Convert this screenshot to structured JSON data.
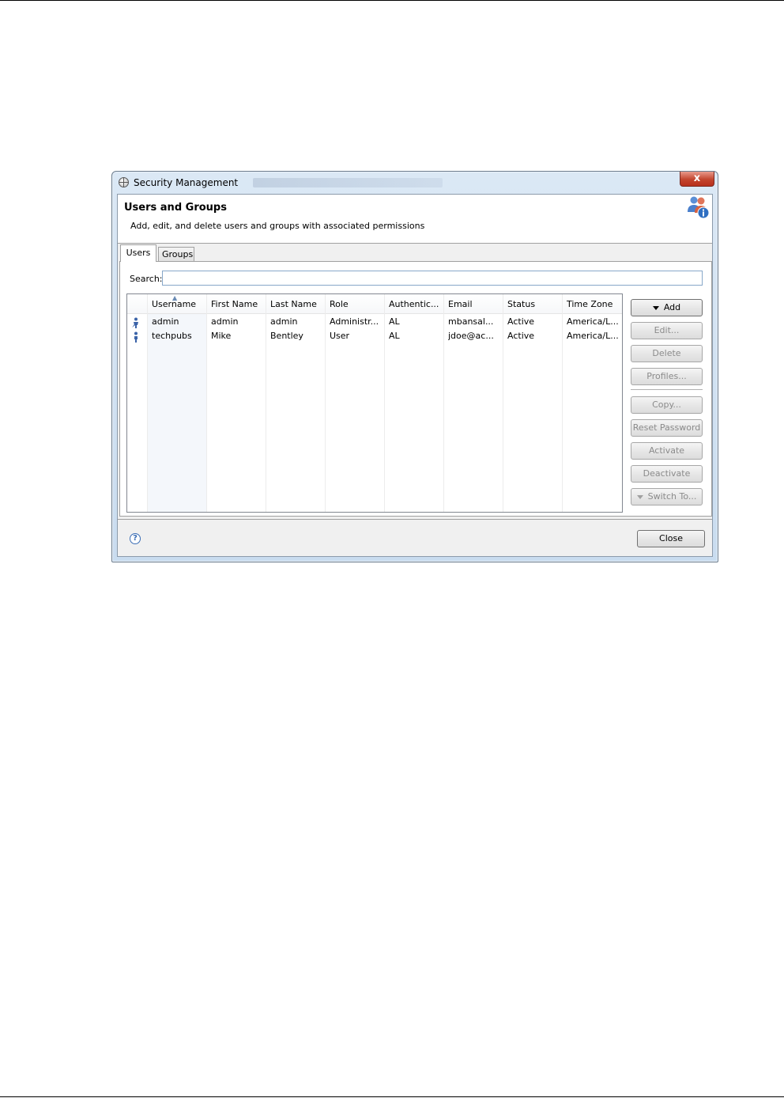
{
  "window": {
    "title": "Security Management",
    "close_glyph": "x"
  },
  "header": {
    "title": "Users and Groups",
    "description": "Add, edit, and delete users and groups with associated permissions",
    "icon": "users-info-icon"
  },
  "tabs": [
    {
      "label": "Users",
      "selected": true
    },
    {
      "label": "Groups",
      "selected": false
    }
  ],
  "search": {
    "label": "Search:",
    "value": "",
    "placeholder": ""
  },
  "table": {
    "columns": [
      "Username",
      "First Name",
      "Last Name",
      "Role",
      "Authentic...",
      "Email",
      "Status",
      "Time Zone"
    ],
    "sorted_column": "Username",
    "rows": [
      {
        "icon": "admin-user-icon",
        "username": "admin",
        "first_name": "admin",
        "last_name": "admin",
        "role": "Administr...",
        "auth": "AL",
        "email": "mbansal...",
        "status": "Active",
        "timezone": "America/L..."
      },
      {
        "icon": "user-icon",
        "username": "techpubs",
        "first_name": "Mike",
        "last_name": "Bentley",
        "role": "User",
        "auth": "AL",
        "email": "jdoe@ac...",
        "status": "Active",
        "timezone": "America/L..."
      }
    ]
  },
  "buttons": {
    "add": "Add",
    "edit": "Edit...",
    "delete": "Delete",
    "profiles": "Profiles...",
    "copy": "Copy...",
    "reset_password": "Reset Password",
    "activate": "Activate",
    "deactivate": "Deactivate",
    "switch_to": "Switch To..."
  },
  "footer": {
    "help": "?",
    "close": "Close"
  },
  "colors": {
    "title_gradient": "#dbe8f5",
    "close_red": "#c3452e",
    "disabled_text": "#8b8b8b"
  }
}
